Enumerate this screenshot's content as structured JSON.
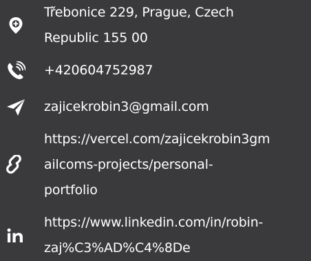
{
  "contacts": [
    {
      "type": "address",
      "icon": "location-pin-icon",
      "lines": [
        "Třebonice 229, Prague, Czech",
        "Republic 155 00"
      ]
    },
    {
      "type": "phone",
      "icon": "phone-ringing-icon",
      "lines": [
        "+420604752987"
      ]
    },
    {
      "type": "email",
      "icon": "paper-plane-icon",
      "lines": [
        "zajicekrobin3@gmail.com"
      ]
    },
    {
      "type": "website",
      "icon": "link-icon",
      "lines": [
        "https://vercel.com/zajicekrobin3gm",
        "ailcoms-projects/personal-",
        "portfolio"
      ]
    },
    {
      "type": "linkedin",
      "icon": "linkedin-icon",
      "lines": [
        "https://www.linkedin.com/in/robin-",
        "zaj%C3%AD%C4%8De"
      ]
    }
  ],
  "colors": {
    "background": "#3a3a3c",
    "text": "#ffffff"
  }
}
